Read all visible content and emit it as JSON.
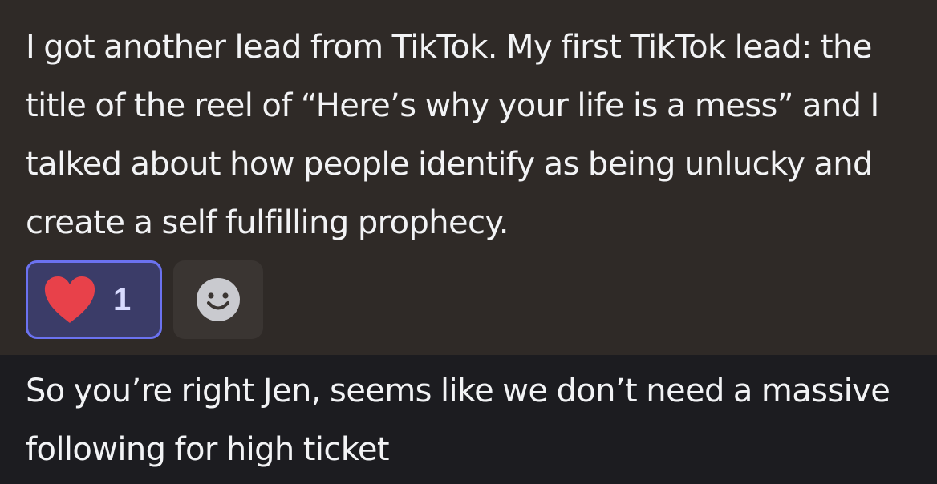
{
  "messages": [
    {
      "text": "I got another lead from TikTok. My first TikTok lead: the title of the reel of “Here’s why your life is a mess” and I talked about how people identify as being unlucky and create a self fulfilling prophecy.",
      "reactions": [
        {
          "icon": "heart-icon",
          "count": "1"
        }
      ],
      "add_reaction_icon": "add-reaction-smile-icon"
    },
    {
      "text": "So you’re right Jen, seems like we don’t need a massive following for high ticket"
    }
  ],
  "colors": {
    "highlight_bg": "#2f2a27",
    "base_bg": "#1c1c20",
    "reaction_bg": "#3b3c68",
    "reaction_border": "#6b72f0",
    "heart": "#e8414a",
    "text": "#f2f3f5"
  }
}
